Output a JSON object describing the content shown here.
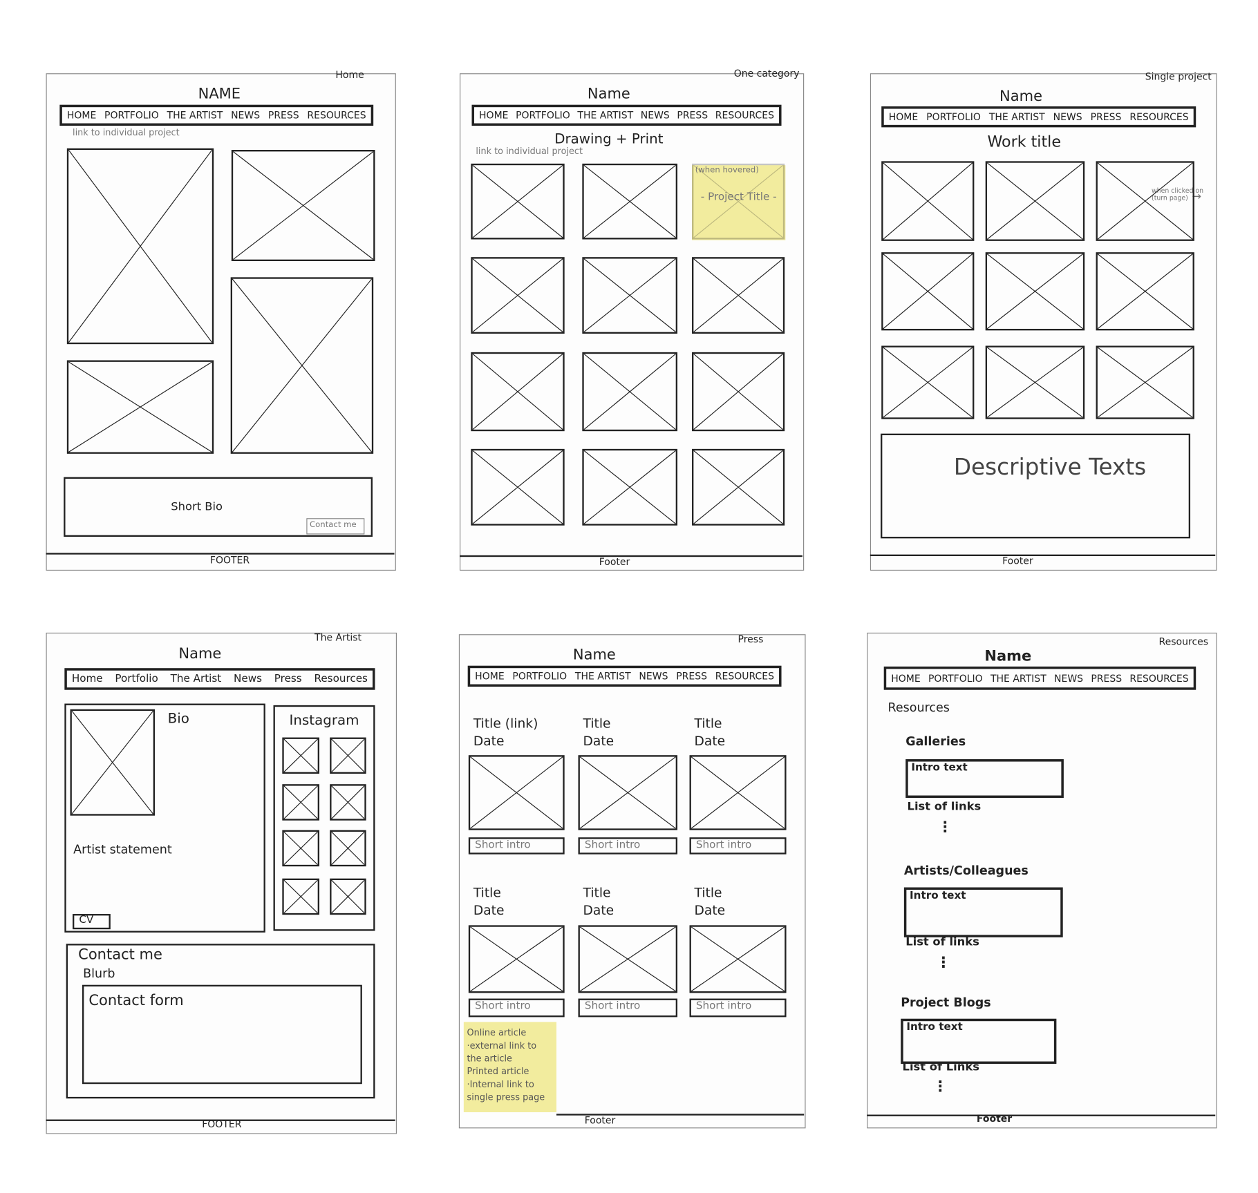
{
  "nav_upper": [
    "HOME",
    "PORTFOLIO",
    "THE ARTIST",
    "NEWS",
    "PRESS",
    "RESOURCES"
  ],
  "nav_mixed": [
    "Home",
    "Portfolio",
    "The Artist",
    "News",
    "Press",
    "Resources"
  ],
  "home": {
    "page_label": "Home",
    "name": "NAME",
    "note": "link to individual project",
    "bio": "Short Bio",
    "contact": "Contact me",
    "footer": "FOOTER"
  },
  "category": {
    "page_label": "One category",
    "name": "Name",
    "heading": "Drawing + Print",
    "note": "link to individual project",
    "hover_note": "(when hovered)",
    "hover_title": "- Project Title -",
    "footer": "Footer"
  },
  "single": {
    "page_label": "Single project",
    "name": "Name",
    "heading": "Work title",
    "note": "when clicked on (turn page)",
    "descriptive": "Descriptive Texts",
    "footer": "Footer"
  },
  "artist": {
    "page_label": "The Artist",
    "name": "Name",
    "bio": "Bio",
    "statement": "Artist statement",
    "cv": "CV",
    "instagram": "Instagram",
    "contact": "Contact me",
    "blurb": "Blurb",
    "form": "Contact form",
    "footer": "FOOTER"
  },
  "press": {
    "page_label": "Press",
    "name": "Name",
    "items": [
      {
        "title": "Title (link)",
        "date": "Date",
        "intro": "Short intro"
      },
      {
        "title": "Title",
        "date": "Date",
        "intro": "Short intro"
      },
      {
        "title": "Title",
        "date": "Date",
        "intro": "Short intro"
      },
      {
        "title": "Title",
        "date": "Date",
        "intro": "Short intro"
      },
      {
        "title": "Title",
        "date": "Date",
        "intro": "Short intro"
      },
      {
        "title": "Title",
        "date": "Date",
        "intro": "Short intro"
      }
    ],
    "note": [
      "Online article",
      "·external link to",
      "the article",
      "Printed article",
      "·Internal link to",
      "single press page"
    ],
    "footer": "Footer"
  },
  "resources": {
    "page_label": "Resources",
    "name": "Name",
    "heading": "Resources",
    "sections": [
      {
        "title": "Galleries",
        "intro": "Intro text",
        "links": "List of links"
      },
      {
        "title": "Artists/Colleagues",
        "intro": "Intro text",
        "links": "List of links"
      },
      {
        "title": "Project Blogs",
        "intro": "Intro text",
        "links": "List of Links"
      }
    ],
    "dots": "⋮",
    "footer": "Footer"
  },
  "colors": {
    "sticky_note": "#f2ec9e",
    "ink": "#222222"
  }
}
